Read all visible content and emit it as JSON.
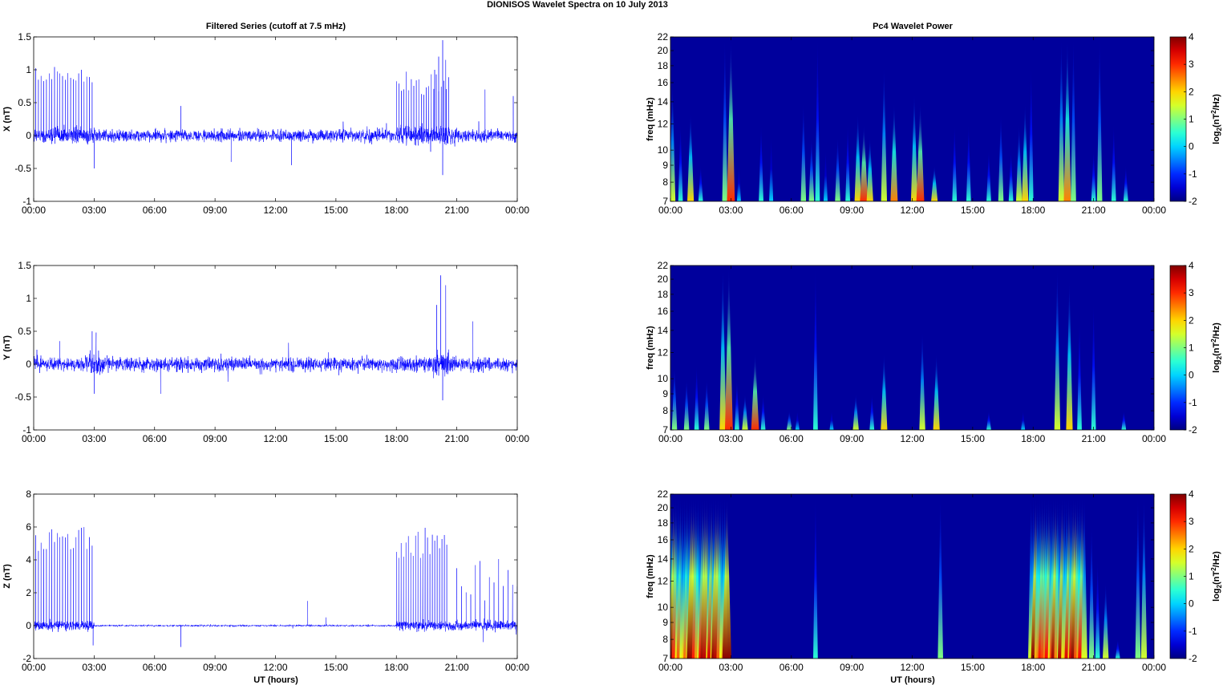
{
  "figure_title": "DIONISOS Wavelet Spectra on 10 July      2013",
  "left_title": "Filtered Series (cutoff at 7.5 mHz)",
  "right_title": "Pc4 Wavelet Power",
  "x_label": "UT (hours)",
  "time_ticks": [
    "00:00",
    "03:00",
    "06:00",
    "09:00",
    "12:00",
    "15:00",
    "18:00",
    "21:00",
    "00:00"
  ],
  "colors": {
    "series": "#0000ff",
    "background": "#00009c"
  },
  "chart_data": [
    {
      "type": "line",
      "name": "X",
      "ylabel": "X (nT)",
      "xlim": [
        0,
        24
      ],
      "ylim": [
        -1,
        1.5
      ],
      "yticks": [
        -1,
        -0.5,
        0,
        0.5,
        1,
        1.5
      ],
      "ytick_labels": [
        "-1",
        "-0.5",
        "0",
        "0.5",
        "1",
        "1.5"
      ],
      "noise": [
        {
          "start": 0,
          "end": 24,
          "amp": 0.09
        },
        {
          "start": 0.3,
          "end": 3.2,
          "amp": 0.12
        },
        {
          "start": 18,
          "end": 21,
          "amp": 0.14
        }
      ],
      "spike_trains": [
        {
          "start": 0.1,
          "end": 2.9,
          "count": 22,
          "amp": [
            0.8,
            1.05
          ]
        },
        {
          "start": 18.0,
          "end": 20.6,
          "count": 22,
          "amp": [
            0.6,
            1.0
          ]
        }
      ],
      "spikes": [
        [
          20.3,
          1.45
        ],
        [
          20.1,
          1.2
        ],
        [
          20.45,
          1.15
        ],
        [
          19.9,
          1.0
        ],
        [
          22.4,
          0.7
        ],
        [
          23.8,
          0.6
        ],
        [
          7.3,
          0.45
        ],
        [
          3.0,
          -0.5
        ],
        [
          20.3,
          -0.6
        ],
        [
          12.8,
          -0.45
        ],
        [
          9.8,
          -0.4
        ]
      ]
    },
    {
      "type": "line",
      "name": "Y",
      "ylabel": "Y (nT)",
      "xlim": [
        0,
        24
      ],
      "ylim": [
        -1,
        1.5
      ],
      "yticks": [
        -1,
        -0.5,
        0,
        0.5,
        1,
        1.5
      ],
      "ytick_labels": [
        "-1",
        "-0.5",
        "0",
        "0.5",
        "1",
        "1.5"
      ],
      "noise": [
        {
          "start": 0,
          "end": 24,
          "amp": 0.1
        },
        {
          "start": 2.5,
          "end": 3.5,
          "amp": 0.18
        },
        {
          "start": 19.8,
          "end": 20.6,
          "amp": 0.22
        }
      ],
      "spike_trains": [],
      "spikes": [
        [
          2.9,
          0.5
        ],
        [
          3.1,
          0.48
        ],
        [
          20.2,
          1.35
        ],
        [
          20.45,
          1.2
        ],
        [
          20.0,
          0.9
        ],
        [
          21.8,
          0.65
        ],
        [
          3.0,
          -0.45
        ],
        [
          20.3,
          -0.55
        ],
        [
          6.3,
          -0.45
        ],
        [
          1.3,
          0.35
        ]
      ]
    },
    {
      "type": "line",
      "name": "Z",
      "ylabel": "Z (nT)",
      "xlim": [
        0,
        24
      ],
      "ylim": [
        -2,
        8
      ],
      "yticks": [
        -2,
        0,
        2,
        4,
        6,
        8
      ],
      "ytick_labels": [
        "-2",
        "0",
        "2",
        "4",
        "6",
        "8"
      ],
      "noise": [
        {
          "start": 0,
          "end": 3,
          "amp": 0.3
        },
        {
          "start": 3,
          "end": 18,
          "amp": 0.06
        },
        {
          "start": 18,
          "end": 24,
          "amp": 0.3
        }
      ],
      "spike_trains": [
        {
          "start": 0.1,
          "end": 2.9,
          "count": 22,
          "amp": [
            4.5,
            6.0
          ]
        },
        {
          "start": 18.0,
          "end": 20.5,
          "count": 22,
          "amp": [
            4.0,
            6.0
          ]
        },
        {
          "start": 21.0,
          "end": 24,
          "count": 14,
          "amp": [
            1.5,
            4.5
          ]
        }
      ],
      "spikes": [
        [
          13.6,
          1.5
        ],
        [
          7.3,
          -1.3
        ],
        [
          2.95,
          -1.2
        ],
        [
          22.3,
          -1.0
        ],
        [
          14.5,
          0.5
        ]
      ]
    },
    {
      "type": "heatmap",
      "name": "X power",
      "ylabel": "freq (mHz)",
      "xlim": [
        0,
        24
      ],
      "ylim": [
        7,
        22
      ],
      "yscale": "log",
      "yticks": [
        7,
        8,
        9,
        10,
        12,
        14,
        16,
        18,
        20,
        22
      ],
      "ytick_labels": [
        "7",
        "8",
        "9",
        "10",
        "12",
        "14",
        "16",
        "18",
        "20",
        "22"
      ],
      "colorbar": {
        "label": "log2(nT^2/Hz)",
        "range": [
          -2,
          4
        ],
        "ticks": [
          "-2",
          "-1",
          "0",
          "1",
          "2",
          "3",
          "4"
        ]
      },
      "trains": [],
      "events": [
        [
          0.1,
          16,
          1.5
        ],
        [
          0.5,
          12,
          0.5
        ],
        [
          1.0,
          13,
          2
        ],
        [
          1.5,
          9,
          0.5
        ],
        [
          2.7,
          22,
          1
        ],
        [
          3.0,
          22,
          3
        ],
        [
          3.4,
          9,
          0
        ],
        [
          4.5,
          12,
          0.5
        ],
        [
          5.0,
          11,
          0
        ],
        [
          6.6,
          14,
          1
        ],
        [
          7.0,
          11,
          1
        ],
        [
          7.3,
          22,
          0.5
        ],
        [
          7.7,
          10,
          0
        ],
        [
          8.3,
          11,
          1
        ],
        [
          8.8,
          12,
          0.5
        ],
        [
          9.3,
          13,
          2
        ],
        [
          9.6,
          12,
          3
        ],
        [
          9.9,
          11,
          2
        ],
        [
          10.6,
          18,
          1.5
        ],
        [
          11.1,
          14,
          2.5
        ],
        [
          12.1,
          15,
          2
        ],
        [
          12.4,
          14,
          3
        ],
        [
          13.1,
          9,
          2
        ],
        [
          14.1,
          12,
          0.5
        ],
        [
          14.8,
          12,
          0.5
        ],
        [
          15.8,
          10,
          0.5
        ],
        [
          16.4,
          13,
          1
        ],
        [
          16.9,
          10,
          0.5
        ],
        [
          17.3,
          12,
          1.5
        ],
        [
          17.6,
          14,
          2
        ],
        [
          17.9,
          18,
          0.5
        ],
        [
          19.4,
          22,
          1.5
        ],
        [
          19.7,
          22,
          2.5
        ],
        [
          20.0,
          22,
          1
        ],
        [
          21.0,
          10,
          0.5
        ],
        [
          21.3,
          22,
          1
        ],
        [
          22.0,
          12,
          0.5
        ],
        [
          22.6,
          9,
          0.5
        ]
      ]
    },
    {
      "type": "heatmap",
      "name": "Y power",
      "ylabel": "freq (mHz)",
      "xlim": [
        0,
        24
      ],
      "ylim": [
        7,
        22
      ],
      "yscale": "log",
      "yticks": [
        7,
        8,
        9,
        10,
        12,
        14,
        16,
        18,
        20,
        22
      ],
      "ytick_labels": [
        "7",
        "8",
        "9",
        "10",
        "12",
        "14",
        "16",
        "18",
        "20",
        "22"
      ],
      "colorbar": {
        "label": "log2(nT^2/Hz)",
        "range": [
          -2,
          4
        ],
        "ticks": [
          "-2",
          "-1",
          "0",
          "1",
          "2",
          "3",
          "4"
        ]
      },
      "trains": [],
      "events": [
        [
          0.2,
          11,
          1
        ],
        [
          0.8,
          10,
          1
        ],
        [
          1.3,
          11,
          0.5
        ],
        [
          1.8,
          10,
          1
        ],
        [
          2.6,
          22,
          2
        ],
        [
          2.9,
          22,
          3
        ],
        [
          3.3,
          10,
          0.5
        ],
        [
          3.7,
          9,
          1.5
        ],
        [
          4.2,
          12,
          3
        ],
        [
          4.6,
          9,
          0.5
        ],
        [
          5.9,
          8,
          1
        ],
        [
          6.3,
          8,
          0
        ],
        [
          7.2,
          22,
          0.5
        ],
        [
          8.0,
          8,
          0
        ],
        [
          9.2,
          9,
          1.5
        ],
        [
          10.0,
          9,
          0.5
        ],
        [
          10.6,
          12,
          2
        ],
        [
          12.5,
          14,
          1.5
        ],
        [
          13.2,
          12,
          2
        ],
        [
          15.8,
          8,
          0.5
        ],
        [
          17.5,
          8,
          0
        ],
        [
          19.2,
          22,
          1.5
        ],
        [
          19.8,
          20,
          2
        ],
        [
          20.3,
          15,
          0.5
        ],
        [
          21.0,
          17,
          0.5
        ],
        [
          22.5,
          8,
          0.5
        ]
      ]
    },
    {
      "type": "heatmap",
      "name": "Z power",
      "ylabel": "freq (mHz)",
      "xlim": [
        0,
        24
      ],
      "ylim": [
        7,
        22
      ],
      "yscale": "log",
      "yticks": [
        7,
        8,
        9,
        10,
        12,
        14,
        16,
        18,
        20,
        22
      ],
      "ytick_labels": [
        "7",
        "8",
        "9",
        "10",
        "12",
        "14",
        "16",
        "18",
        "20",
        "22"
      ],
      "colorbar": {
        "label": "log2(nT^2/Hz)",
        "range": [
          -2,
          4
        ],
        "ticks": [
          "-2",
          "-1",
          "0",
          "1",
          "2",
          "3",
          "4"
        ]
      },
      "trains": [
        {
          "start": 0.05,
          "end": 2.9,
          "step": 0.11,
          "top": 22,
          "power": [
            1.5,
            4
          ]
        },
        {
          "start": 17.9,
          "end": 20.6,
          "step": 0.11,
          "top": 22,
          "power": [
            1.5,
            4
          ]
        }
      ],
      "events": [
        [
          7.2,
          22,
          0.5
        ],
        [
          13.4,
          22,
          1
        ],
        [
          21.2,
          14,
          0.5
        ],
        [
          21.6,
          12,
          1.5
        ],
        [
          22.2,
          8,
          0.5
        ],
        [
          23.2,
          22,
          1
        ],
        [
          23.5,
          22,
          1.5
        ],
        [
          20.9,
          18,
          1
        ]
      ]
    }
  ]
}
